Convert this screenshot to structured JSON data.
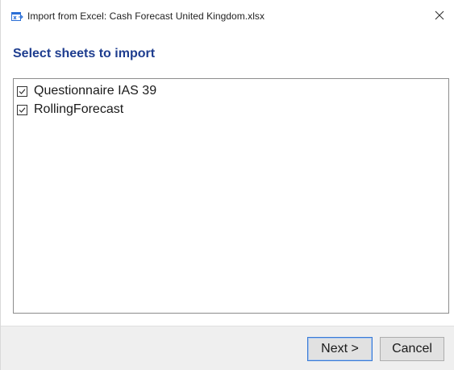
{
  "window": {
    "title": "Import from Excel: Cash Forecast United Kingdom.xlsx",
    "icon": "excel-import-icon",
    "close_icon": "close-icon"
  },
  "header": {
    "title": "Select sheets to import",
    "color": "#1e3d8f"
  },
  "sheets": [
    {
      "label": "Questionnaire IAS 39",
      "checked": true
    },
    {
      "label": "RollingForecast",
      "checked": true
    }
  ],
  "footer": {
    "next_label": "Next >",
    "cancel_label": "Cancel"
  }
}
